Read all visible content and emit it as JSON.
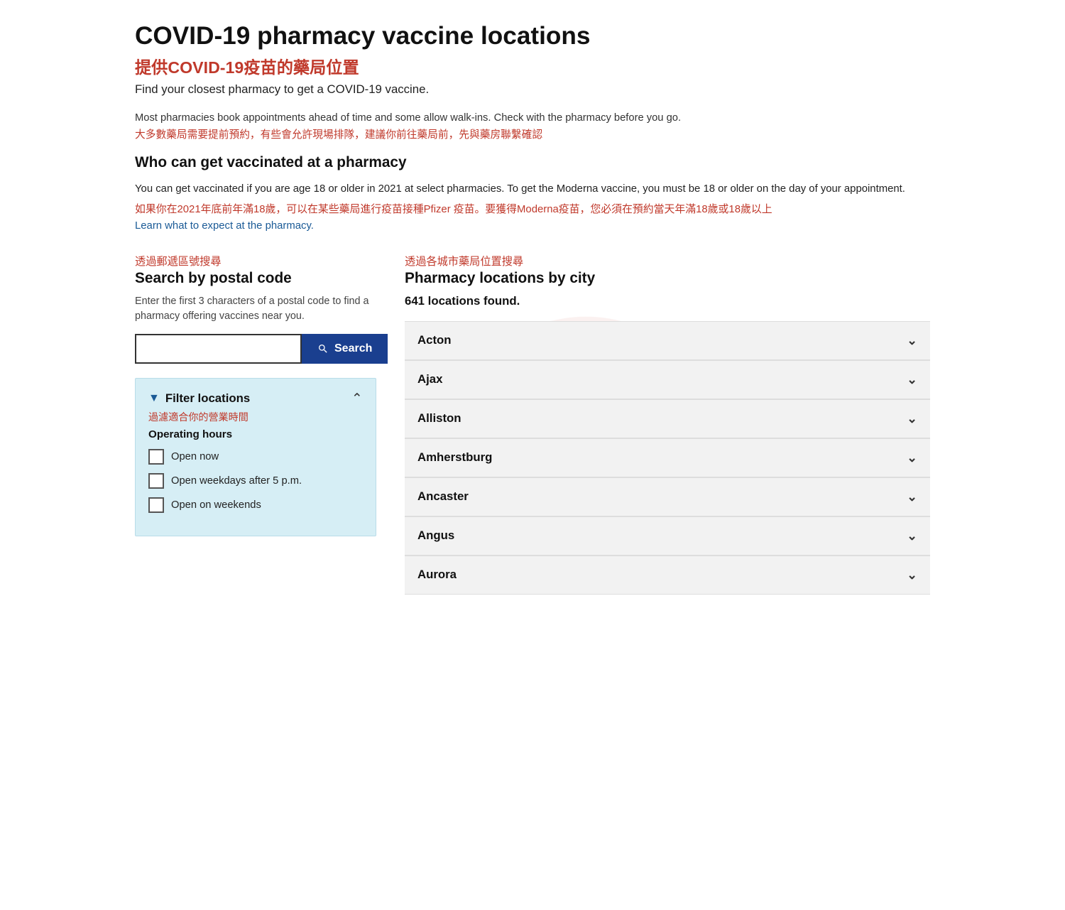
{
  "page": {
    "main_title": "COVID-19 pharmacy vaccine locations",
    "main_title_chinese": "提供COVID-19疫苗的藥局位置",
    "subtitle": "Find your closest pharmacy to get a COVID-19 vaccine.",
    "info_text": "Most pharmacies book appointments ahead of time and some allow walk-ins. Check with the pharmacy before you go.",
    "info_chinese": "大多數藥局需要提前預約，有些會允許現場排隊，建議你前往藥局前，先與藥房聯繫確認",
    "who_heading": "Who can get vaccinated at a pharmacy",
    "eligibility_text": "You can get vaccinated if you are age 18 or older in 2021 at select pharmacies. To get the Moderna vaccine, you must be 18 or older on the day of your appointment.",
    "eligibility_chinese": "如果你在2021年底前年滿18歲，可以在某些藥局進行疫苗接種Pfizer 疫苗。要獲得Moderna疫苗，您必須在預約當天年滿18歲或18歲以上",
    "learn_link": "Learn what to expect at the pharmacy."
  },
  "postal": {
    "label_chinese": "透過郵遞區號搜尋",
    "heading": "Search by postal code",
    "description": "Enter the first 3 characters of a postal code to find a pharmacy offering vaccines near you.",
    "input_placeholder": "",
    "search_button": "Search"
  },
  "filter": {
    "label": "Filter locations",
    "label_chinese": "過濾適合你的營業時間",
    "subheading": "Operating hours",
    "toggle_icon": "chevron-up",
    "options": [
      {
        "id": "open_now",
        "label": "Open now",
        "checked": false
      },
      {
        "id": "open_weekdays",
        "label": "Open weekdays after 5 p.m.",
        "checked": false
      },
      {
        "id": "open_weekends",
        "label": "Open on weekends",
        "checked": false
      }
    ]
  },
  "city_section": {
    "label_chinese": "透過各城市藥局位置搜尋",
    "heading": "Pharmacy locations by city",
    "locations_count": "641 locations found.",
    "cities": [
      "Acton",
      "Ajax",
      "Alliston",
      "Amherstburg",
      "Ancaster",
      "Angus",
      "Aurora"
    ]
  }
}
